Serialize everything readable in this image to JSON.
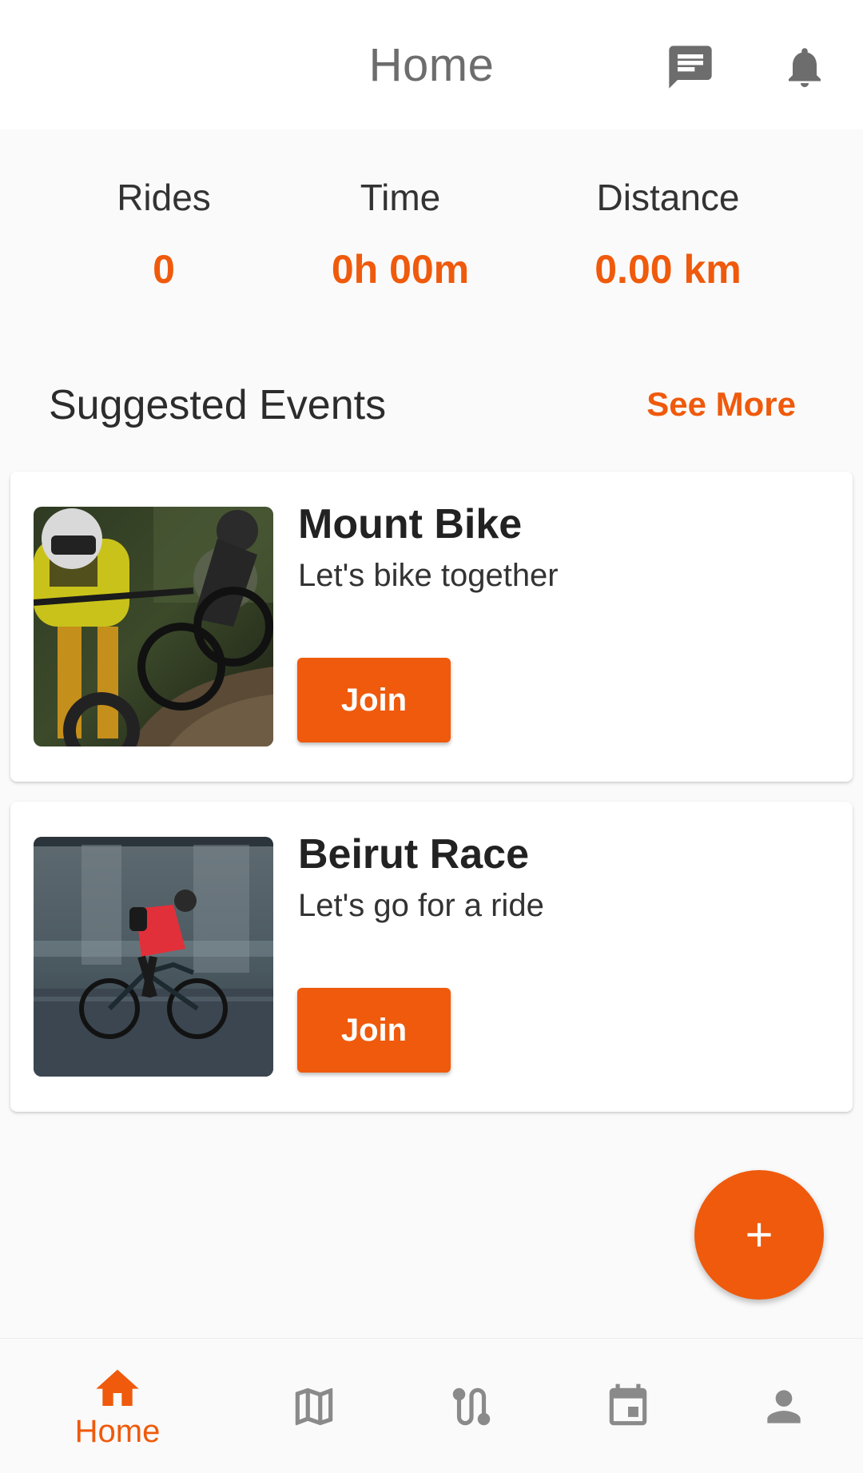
{
  "header": {
    "title": "Home",
    "chat_icon": "chat-icon",
    "bell_icon": "bell-icon"
  },
  "stats": {
    "rides": {
      "label": "Rides",
      "value": "0"
    },
    "time": {
      "label": "Time",
      "value": "0h 00m"
    },
    "distance": {
      "label": "Distance",
      "value": "0.00 km"
    }
  },
  "events_section": {
    "title": "Suggested Events",
    "see_more": "See More"
  },
  "events": [
    {
      "name": "Mount Bike",
      "description": "Let's bike together",
      "join_label": "Join",
      "image": "mountain-bike-photo"
    },
    {
      "name": "Beirut Race",
      "description": "Let's go for a ride",
      "join_label": "Join",
      "image": "city-cyclist-photo"
    }
  ],
  "fab": {
    "icon": "plus-icon"
  },
  "bottom_nav": {
    "items": [
      {
        "id": "home",
        "label": "Home",
        "icon": "home-icon",
        "active": true
      },
      {
        "id": "map",
        "label": "",
        "icon": "map-icon",
        "active": false
      },
      {
        "id": "routes",
        "label": "",
        "icon": "route-icon",
        "active": false
      },
      {
        "id": "events",
        "label": "",
        "icon": "calendar-icon",
        "active": false
      },
      {
        "id": "profile",
        "label": "",
        "icon": "person-icon",
        "active": false
      }
    ]
  },
  "colors": {
    "accent": "#ef5a0c",
    "icon_gray": "#6d6d6d",
    "nav_gray": "#8a8a8a",
    "background": "#fafafa"
  }
}
